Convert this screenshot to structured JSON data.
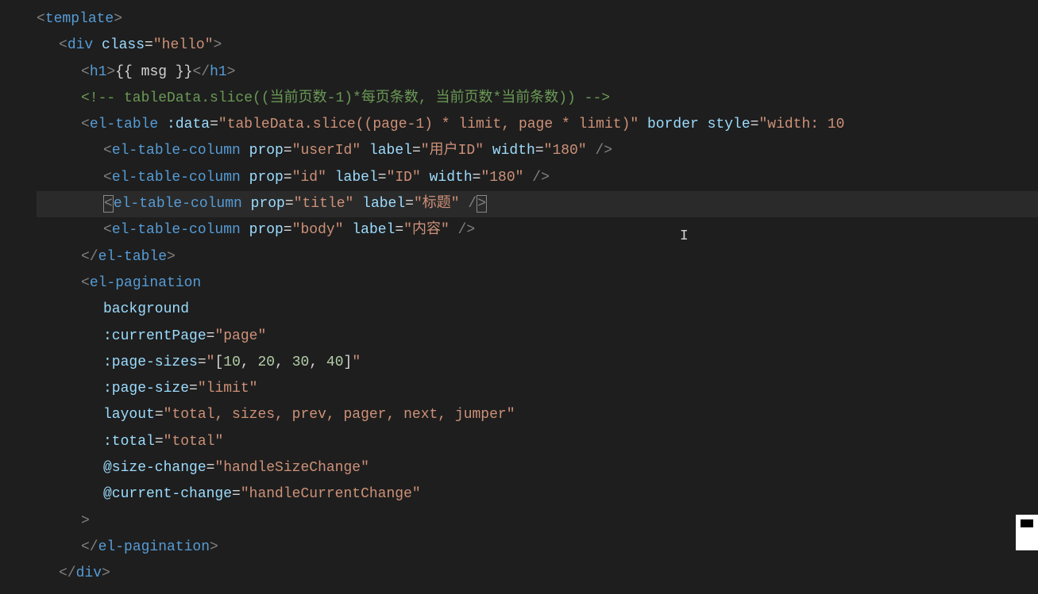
{
  "code": {
    "l1": {
      "open": "<",
      "tag": "template",
      "close": ">"
    },
    "l2": {
      "open": "<",
      "tag": "div",
      "attr1": "class",
      "eq": "=",
      "q": "\"",
      "val1": "hello",
      "close": ">"
    },
    "l3": {
      "open": "<",
      "tag": "h1",
      "close": ">",
      "text": "{{ msg }}",
      "open2": "</",
      "close2": ">"
    },
    "l4": {
      "comment": "<!-- tableData.slice((当前页数-1)*每页条数, 当前页数*当前条数)) -->"
    },
    "l5": {
      "open": "<",
      "tag": "el-table",
      "attr1": ":data",
      "val1": "tableData.slice((page-1) * limit, page * limit)",
      "attr2": "border",
      "attr3": "style",
      "val3": "width: 10"
    },
    "l6": {
      "open": "<",
      "tag": "el-table-column",
      "attr1": "prop",
      "val1": "userId",
      "attr2": "label",
      "val2": "用户ID",
      "attr3": "width",
      "val3": "180",
      "close": "/>"
    },
    "l7": {
      "open": "<",
      "tag": "el-table-column",
      "attr1": "prop",
      "val1": "id",
      "attr2": "label",
      "val2": "ID",
      "attr3": "width",
      "val3": "180",
      "close": "/>"
    },
    "l8": {
      "open": "<",
      "tag": "el-table-column",
      "attr1": "prop",
      "val1": "title",
      "attr2": "label",
      "val2": "标题",
      "close": "/>"
    },
    "l9": {
      "open": "<",
      "tag": "el-table-column",
      "attr1": "prop",
      "val1": "body",
      "attr2": "label",
      "val2": "内容",
      "close": "/>"
    },
    "l10": {
      "open": "</",
      "tag": "el-table",
      "close": ">"
    },
    "l11": {
      "open": "<",
      "tag": "el-pagination"
    },
    "l12": {
      "attr": "background"
    },
    "l13": {
      "attr": ":currentPage",
      "val": "page"
    },
    "l14": {
      "attr": ":page-sizes",
      "q": "\"",
      "b1": "[",
      "n1": "10",
      "c": ", ",
      "n2": "20",
      "n3": "30",
      "n4": "40",
      "b2": "]"
    },
    "l15": {
      "attr": ":page-size",
      "val": "limit"
    },
    "l16": {
      "attr": "layout",
      "val": "total, sizes, prev, pager, next, jumper"
    },
    "l17": {
      "attr": ":total",
      "val": "total"
    },
    "l18": {
      "attr": "@size-change",
      "val": "handleSizeChange"
    },
    "l19": {
      "attr": "@current-change",
      "val": "handleCurrentChange"
    },
    "l20": {
      "close": ">"
    },
    "l21": {
      "open": "</",
      "tag": "el-pagination",
      "close": ">"
    },
    "l22": {
      "open": "</",
      "tag": "div",
      "close": ">"
    }
  }
}
